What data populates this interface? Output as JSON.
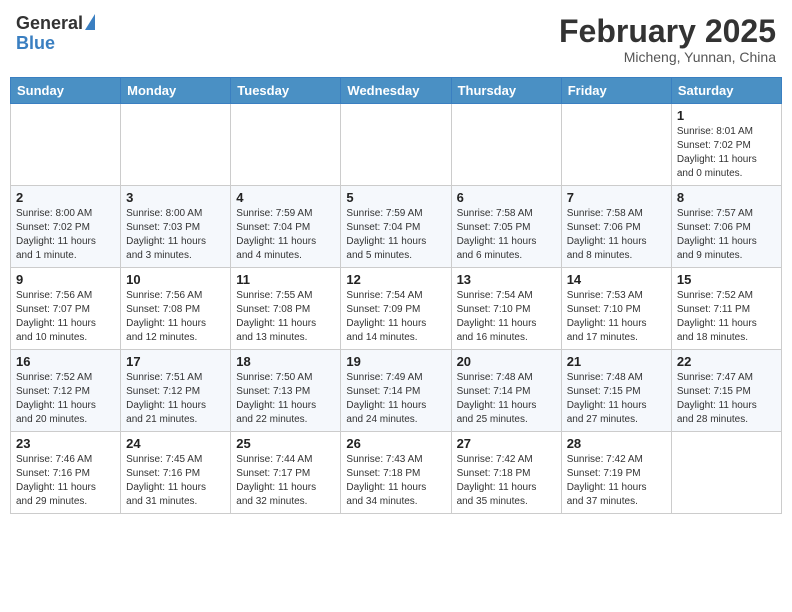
{
  "header": {
    "logo_general": "General",
    "logo_blue": "Blue",
    "month_title": "February 2025",
    "location": "Micheng, Yunnan, China"
  },
  "weekdays": [
    "Sunday",
    "Monday",
    "Tuesday",
    "Wednesday",
    "Thursday",
    "Friday",
    "Saturday"
  ],
  "weeks": [
    [
      {
        "day": "",
        "info": ""
      },
      {
        "day": "",
        "info": ""
      },
      {
        "day": "",
        "info": ""
      },
      {
        "day": "",
        "info": ""
      },
      {
        "day": "",
        "info": ""
      },
      {
        "day": "",
        "info": ""
      },
      {
        "day": "1",
        "info": "Sunrise: 8:01 AM\nSunset: 7:02 PM\nDaylight: 11 hours\nand 0 minutes."
      }
    ],
    [
      {
        "day": "2",
        "info": "Sunrise: 8:00 AM\nSunset: 7:02 PM\nDaylight: 11 hours\nand 1 minute."
      },
      {
        "day": "3",
        "info": "Sunrise: 8:00 AM\nSunset: 7:03 PM\nDaylight: 11 hours\nand 3 minutes."
      },
      {
        "day": "4",
        "info": "Sunrise: 7:59 AM\nSunset: 7:04 PM\nDaylight: 11 hours\nand 4 minutes."
      },
      {
        "day": "5",
        "info": "Sunrise: 7:59 AM\nSunset: 7:04 PM\nDaylight: 11 hours\nand 5 minutes."
      },
      {
        "day": "6",
        "info": "Sunrise: 7:58 AM\nSunset: 7:05 PM\nDaylight: 11 hours\nand 6 minutes."
      },
      {
        "day": "7",
        "info": "Sunrise: 7:58 AM\nSunset: 7:06 PM\nDaylight: 11 hours\nand 8 minutes."
      },
      {
        "day": "8",
        "info": "Sunrise: 7:57 AM\nSunset: 7:06 PM\nDaylight: 11 hours\nand 9 minutes."
      }
    ],
    [
      {
        "day": "9",
        "info": "Sunrise: 7:56 AM\nSunset: 7:07 PM\nDaylight: 11 hours\nand 10 minutes."
      },
      {
        "day": "10",
        "info": "Sunrise: 7:56 AM\nSunset: 7:08 PM\nDaylight: 11 hours\nand 12 minutes."
      },
      {
        "day": "11",
        "info": "Sunrise: 7:55 AM\nSunset: 7:08 PM\nDaylight: 11 hours\nand 13 minutes."
      },
      {
        "day": "12",
        "info": "Sunrise: 7:54 AM\nSunset: 7:09 PM\nDaylight: 11 hours\nand 14 minutes."
      },
      {
        "day": "13",
        "info": "Sunrise: 7:54 AM\nSunset: 7:10 PM\nDaylight: 11 hours\nand 16 minutes."
      },
      {
        "day": "14",
        "info": "Sunrise: 7:53 AM\nSunset: 7:10 PM\nDaylight: 11 hours\nand 17 minutes."
      },
      {
        "day": "15",
        "info": "Sunrise: 7:52 AM\nSunset: 7:11 PM\nDaylight: 11 hours\nand 18 minutes."
      }
    ],
    [
      {
        "day": "16",
        "info": "Sunrise: 7:52 AM\nSunset: 7:12 PM\nDaylight: 11 hours\nand 20 minutes."
      },
      {
        "day": "17",
        "info": "Sunrise: 7:51 AM\nSunset: 7:12 PM\nDaylight: 11 hours\nand 21 minutes."
      },
      {
        "day": "18",
        "info": "Sunrise: 7:50 AM\nSunset: 7:13 PM\nDaylight: 11 hours\nand 22 minutes."
      },
      {
        "day": "19",
        "info": "Sunrise: 7:49 AM\nSunset: 7:14 PM\nDaylight: 11 hours\nand 24 minutes."
      },
      {
        "day": "20",
        "info": "Sunrise: 7:48 AM\nSunset: 7:14 PM\nDaylight: 11 hours\nand 25 minutes."
      },
      {
        "day": "21",
        "info": "Sunrise: 7:48 AM\nSunset: 7:15 PM\nDaylight: 11 hours\nand 27 minutes."
      },
      {
        "day": "22",
        "info": "Sunrise: 7:47 AM\nSunset: 7:15 PM\nDaylight: 11 hours\nand 28 minutes."
      }
    ],
    [
      {
        "day": "23",
        "info": "Sunrise: 7:46 AM\nSunset: 7:16 PM\nDaylight: 11 hours\nand 29 minutes."
      },
      {
        "day": "24",
        "info": "Sunrise: 7:45 AM\nSunset: 7:16 PM\nDaylight: 11 hours\nand 31 minutes."
      },
      {
        "day": "25",
        "info": "Sunrise: 7:44 AM\nSunset: 7:17 PM\nDaylight: 11 hours\nand 32 minutes."
      },
      {
        "day": "26",
        "info": "Sunrise: 7:43 AM\nSunset: 7:18 PM\nDaylight: 11 hours\nand 34 minutes."
      },
      {
        "day": "27",
        "info": "Sunrise: 7:42 AM\nSunset: 7:18 PM\nDaylight: 11 hours\nand 35 minutes."
      },
      {
        "day": "28",
        "info": "Sunrise: 7:42 AM\nSunset: 7:19 PM\nDaylight: 11 hours\nand 37 minutes."
      },
      {
        "day": "",
        "info": ""
      }
    ]
  ]
}
